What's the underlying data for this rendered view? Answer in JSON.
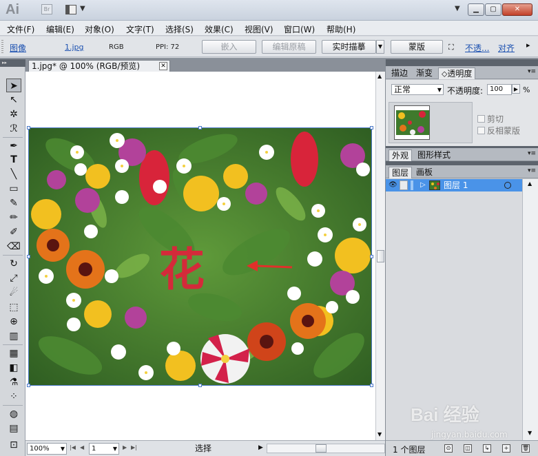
{
  "app": {
    "logo": "Ai",
    "bridge": "Br"
  },
  "menu": [
    "文件(F)",
    "编辑(E)",
    "对象(O)",
    "文字(T)",
    "选择(S)",
    "效果(C)",
    "视图(V)",
    "窗口(W)",
    "帮助(H)"
  ],
  "control": {
    "object_type": "图像",
    "file_link": "1.jpg",
    "color_mode": "RGB",
    "ppi": "PPI: 72",
    "embed": "嵌入",
    "edit_original": "编辑原稿",
    "live_trace": "实时描摹",
    "mask": "蒙版",
    "opacity_link": "不透...",
    "align_link": "对齐"
  },
  "document": {
    "tab_title": "1.jpg* @ 100% (RGB/预览)",
    "close": "✕",
    "artwork_text": "花"
  },
  "status": {
    "zoom": "100%",
    "page": "1",
    "tool": "选择"
  },
  "transparency_panel": {
    "tabs": [
      "描边",
      "渐变",
      "透明度"
    ],
    "blend_mode": "正常",
    "opacity_label": "不透明度:",
    "opacity_value": "100",
    "opacity_unit": "%",
    "clip": "剪切",
    "invert_mask": "反相蒙版"
  },
  "appearance_panel": {
    "tabs": [
      "外观",
      "图形样式"
    ]
  },
  "layers_panel": {
    "tabs": [
      "图层",
      "画板"
    ],
    "layer_name": "图层 1",
    "count": "1 个图层"
  },
  "watermark": {
    "logo": "Bai 经验",
    "sub": "jingyan.baidu.com"
  },
  "colors": {
    "accent": "#4a93e8",
    "link": "#1b50b0",
    "text_red": "#d42a3a"
  }
}
